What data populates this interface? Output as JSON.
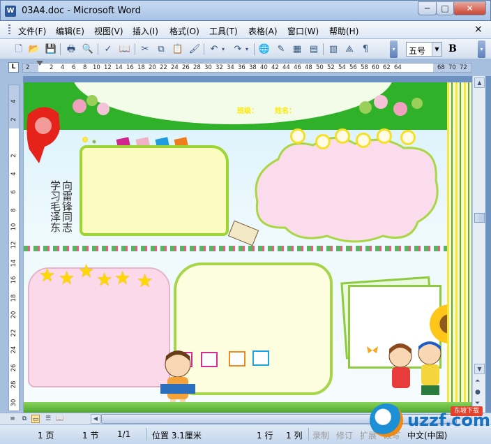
{
  "window": {
    "icon_letter": "W",
    "title": "03A4.doc - Microsoft Word",
    "min_glyph": "─",
    "max_glyph": "□",
    "close_glyph": "✕"
  },
  "menu": {
    "items": [
      "文件(F)",
      "编辑(E)",
      "视图(V)",
      "插入(I)",
      "格式(O)",
      "工具(T)",
      "表格(A)",
      "窗口(W)",
      "帮助(H)"
    ],
    "close_doc": "×"
  },
  "toolbar": {
    "font_size": "五号",
    "bold_label": "B",
    "icons": [
      "new-icon",
      "open-icon",
      "save-icon",
      "print-icon",
      "print-preview-icon",
      "spelling-icon",
      "research-icon",
      "cut-icon",
      "copy-icon",
      "paste-icon",
      "format-painter-icon",
      "undo-icon",
      "redo-icon",
      "hyperlink-icon",
      "tables-borders-icon",
      "insert-table-icon",
      "insert-excel-icon",
      "columns-icon",
      "drawing-icon",
      "document-map-icon"
    ]
  },
  "ruler": {
    "corner": "L",
    "marks": [
      "2",
      "2",
      "4",
      "6",
      "8",
      "10",
      "12",
      "14",
      "16",
      "18",
      "20",
      "22",
      "24",
      "26",
      "28",
      "30",
      "32",
      "34",
      "36",
      "38",
      "40",
      "42",
      "44",
      "46",
      "48",
      "50",
      "52",
      "54",
      "56",
      "58",
      "60",
      "62",
      "64",
      "68",
      "70",
      "72"
    ],
    "vmarks": [
      "4",
      "2",
      "2",
      "4",
      "6",
      "8",
      "10",
      "12",
      "14",
      "16",
      "18",
      "20",
      "22",
      "24",
      "26",
      "28",
      "30"
    ]
  },
  "document": {
    "class_label": "班级：",
    "name_label": "姓名：",
    "calligraphy": "向雷锋同志学习毛泽东"
  },
  "colors": {
    "header_green": "#2fb229",
    "label_yellow": "#ffea00",
    "box_border_green": "#9dd534",
    "cloud_pink": "#fadcec",
    "box_pink": "#fbd9eb"
  },
  "status": {
    "page": "1 页",
    "section": "1 节",
    "page_of": "1/1",
    "position": "位置 3.1厘米",
    "line": "1 行",
    "column": "1 列",
    "rec": "录制",
    "trk": "修订",
    "ext": "扩展",
    "ovr": "改写",
    "language": "中文(中国)"
  },
  "watermark": {
    "text": "uzzf.com",
    "badge": "东坡下载"
  }
}
